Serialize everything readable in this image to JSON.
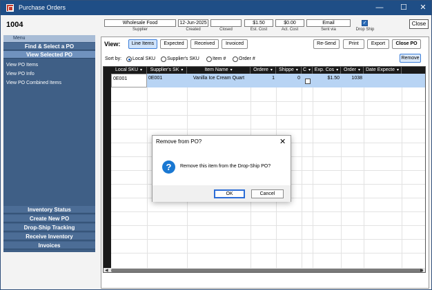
{
  "window": {
    "title": "Purchase Orders",
    "minimize": "—",
    "maximize": "☐",
    "close": "✕"
  },
  "po": {
    "number": "1004"
  },
  "summary": {
    "supplier": {
      "value": "Wholesale Food",
      "label": "Supplier"
    },
    "created": {
      "value": "12-Jun-2025",
      "label": "Created"
    },
    "closed": {
      "value": "",
      "label": "Closed"
    },
    "est_cost": {
      "value": "$1.50",
      "label": "Est. Cost"
    },
    "act_cost": {
      "value": "$0.00",
      "label": "Act. Cost"
    },
    "sent_via": {
      "value": "Email",
      "label": "Sent via"
    },
    "drop_ship": {
      "checked": true,
      "label": "Drop Ship",
      "mark": "✓"
    },
    "close_label": "Close"
  },
  "sidebar": {
    "menu_label": "Menu",
    "top_items": [
      "Find & Select a PO",
      "View Selected PO"
    ],
    "links": [
      "View PO Items",
      "View PO Info",
      "View PO Combined Items"
    ],
    "bottom_items": [
      "Inventory Status",
      "Create New PO",
      "Drop-Ship Tracking",
      "Receive Inventory",
      "Invoices"
    ]
  },
  "view": {
    "label": "View:",
    "tabs": [
      "Line Items",
      "Expected",
      "Received",
      "Invoiced"
    ],
    "actions": [
      "Re-Send",
      "Print",
      "Export",
      "Close PO"
    ],
    "remove_label": "Remove"
  },
  "sort": {
    "label": "Sort by:",
    "options": [
      "Local SKU",
      "Supplier's SKU",
      "Item #",
      "Order #"
    ],
    "selected": "Local SKU"
  },
  "grid": {
    "columns": [
      "Local SKU",
      "Supplier's SK",
      "Item Name",
      "Ordere",
      "Shippe",
      "C",
      "Exp. Cos",
      "Order",
      "Date Expecte"
    ],
    "sort_arrow": "▾",
    "rows": [
      {
        "local_sku": "0E001",
        "supplier_sku": "0E001",
        "item_name": "Vanilla Ice Cream Quart",
        "ordered": "1",
        "shipped": "0",
        "closed": false,
        "exp_cost": "$1.50",
        "order": "1038",
        "date_expected": ""
      }
    ],
    "scroll_left": "◀",
    "scroll_right": "▶"
  },
  "dialog": {
    "title": "Remove from PO?",
    "close": "✕",
    "icon": "?",
    "message": "Remove this item from the Drop-Ship PO?",
    "ok_label": "OK",
    "cancel_label": "Cancel"
  },
  "colors": {
    "titlebar": "#1f4e86",
    "sidebar": "#3f5f86",
    "selected_row": "#b8d4f4",
    "accent": "#1a78d2"
  }
}
